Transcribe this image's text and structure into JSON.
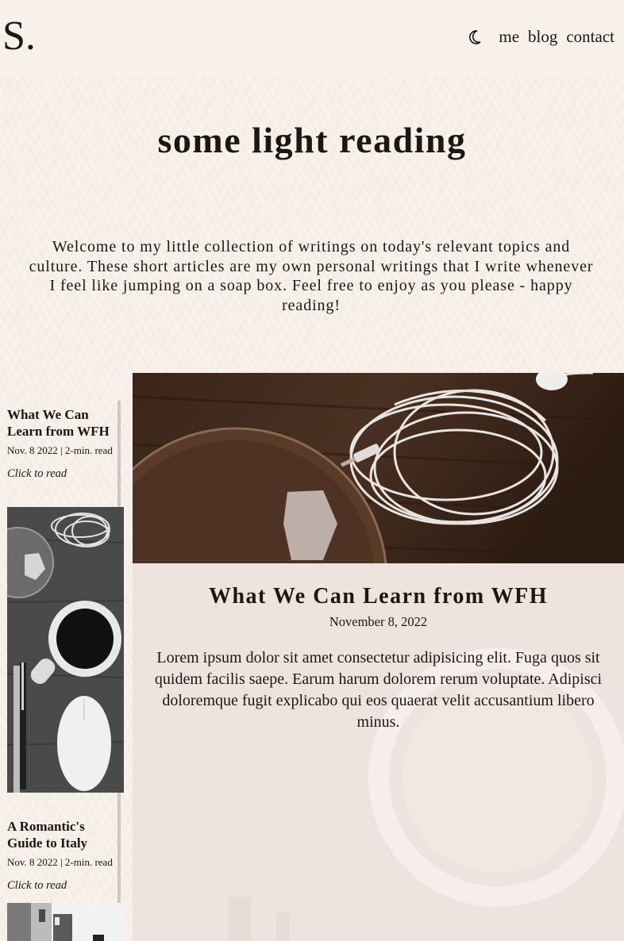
{
  "header": {
    "logo": "S.",
    "nav": [
      {
        "label": "me"
      },
      {
        "label": "blog"
      },
      {
        "label": "contact"
      }
    ],
    "theme_toggle_icon": "moon-icon"
  },
  "hero": {
    "title": "some light reading",
    "intro": "Welcome to my little collection of writings on today's relevant topics and culture. These short articles are my own personal writings that I write whenever I feel like jumping on a soap box. Feel free to enjoy as you please - happy reading!"
  },
  "sidebar": {
    "posts": [
      {
        "title": "What We Can Learn from WFH",
        "meta": "Nov. 8 2022 | 2-min. read",
        "link": "Click to read",
        "image": "desk-flatlay-grayscale"
      },
      {
        "title": "A Romantic's Guide to Italy",
        "meta": "Nov. 8 2022 | 2-min. read",
        "link": "Click to read",
        "image": "italian-street-grayscale"
      }
    ]
  },
  "featured": {
    "image": "earphones-on-wood",
    "title": "What We Can Learn from WFH",
    "date": "November 8, 2022",
    "body": "Lorem ipsum dolor sit amet consectetur adipisicing elit. Fuga quos sit quidem facilis saepe. Earum harum dolorem rerum voluptate. Adipisci doloremque fugit explicabo qui eos quaerat velit accusantium libero minus."
  },
  "colors": {
    "background": "#f7f0eb",
    "text": "#211a14",
    "feature_panel": "#efe4df",
    "sidebar_rule": "#cdc8c4"
  }
}
